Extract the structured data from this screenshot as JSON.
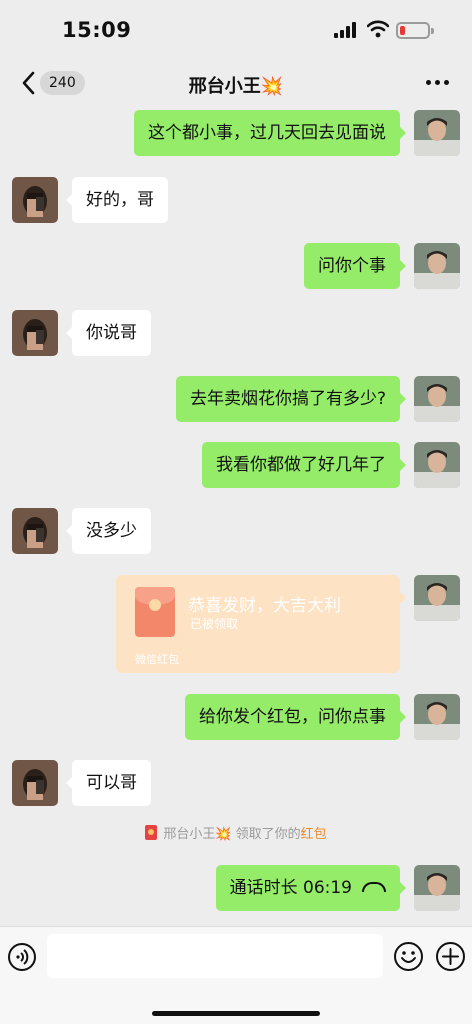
{
  "status_bar": {
    "time": "15:09"
  },
  "nav": {
    "back_count": "240",
    "title": "邢台小王💥"
  },
  "messages": [
    {
      "side": "me",
      "text": "这个都小事，过几天回去见面说"
    },
    {
      "side": "them",
      "text": "好的，哥"
    },
    {
      "side": "me",
      "text": "问你个事"
    },
    {
      "side": "them",
      "text": "你说哥"
    },
    {
      "side": "me",
      "text": "去年卖烟花你搞了有多少?"
    },
    {
      "side": "me",
      "text": "我看你都做了好几年了"
    },
    {
      "side": "them",
      "text": "没多少"
    },
    {
      "side": "me",
      "type": "red_packet",
      "title": "恭喜发财，大吉大利",
      "status": "已被领取",
      "footer": "微信红包"
    },
    {
      "side": "me",
      "text": "给你发个红包，问你点事"
    },
    {
      "side": "them",
      "text": "可以哥"
    },
    {
      "side": "me",
      "type": "call",
      "text": "通话时长 06:19"
    }
  ],
  "system_notice": {
    "name": "邢台小王💥",
    "text": "领取了你的",
    "highlight": "红包"
  },
  "colors": {
    "my_bubble": "#95ec69",
    "their_bubble": "#ffffff",
    "packet": "#fde2c4",
    "background": "#ededed"
  },
  "icons": [
    "back-arrow-icon",
    "more-dots-icon",
    "voice-icon",
    "emoji-icon",
    "plus-icon",
    "call-icon",
    "red-packet-icon"
  ]
}
